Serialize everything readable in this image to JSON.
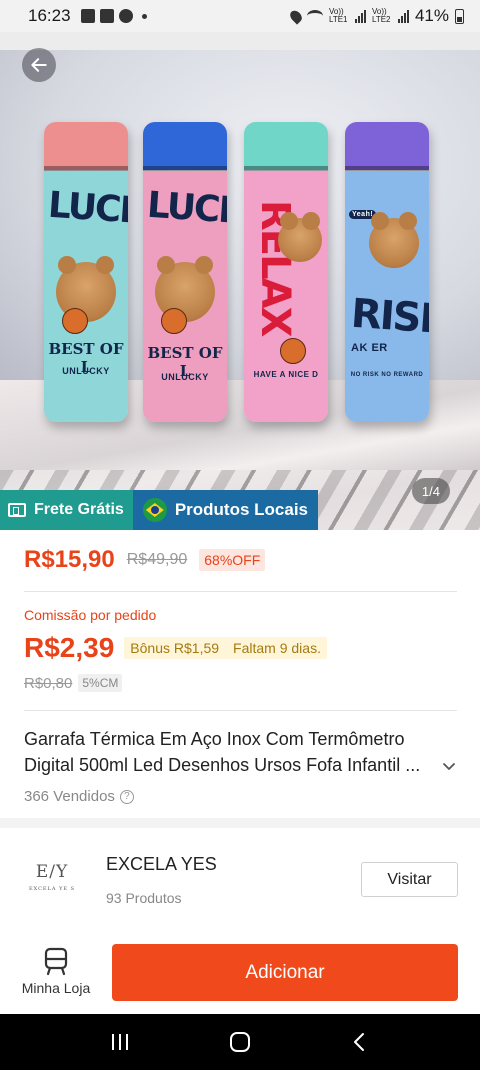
{
  "status_bar": {
    "time": "16:23",
    "battery": "41%",
    "sim1": "Vo)) LTE1",
    "sim2": "Vo)) LTE2"
  },
  "hero": {
    "counter": "1/4",
    "bottle_texts": {
      "b1_big": "LUCK",
      "b1_slogan": "BEST OF L",
      "b1_small": "UNLUCKY",
      "b2_big": "LUCK",
      "b2_slogan": "BEST OF L",
      "b2_small": "UNLUCKY",
      "b3_big": "RELAX",
      "b3_small": "HAVE A NICE D",
      "b4_big": "RISK",
      "b4_sub": "AK ER",
      "b4_small": "NO RISK NO REWARD",
      "b4_bubble": "Yeah!"
    },
    "badges": {
      "frete": "Frete Grátis",
      "locais": "Produtos Locais"
    }
  },
  "price": {
    "current": "R$15,90",
    "original": "R$49,90",
    "discount": "68%OFF"
  },
  "commission": {
    "label": "Comissão por pedido",
    "value": "R$2,39",
    "bonus": "Bônus R$1,59",
    "remaining": "Faltam 9 dias.",
    "old_value": "R$0,80",
    "rate": "5%CM"
  },
  "product": {
    "title_line1": "Garrafa Térmica Em Aço Inox Com Termômetro",
    "title_line2": "Digital 500ml Led Desenhos Ursos Fofa Infantil ...",
    "sold": "366 Vendidos"
  },
  "shop": {
    "logo_mono": "E/Y",
    "logo_sub": "EXCELA YE S",
    "name": "EXCELA YES",
    "count": "93 Produtos",
    "visit_label": "Visitar"
  },
  "bottom": {
    "my_shop_label": "Minha Loja",
    "add_label": "Adicionar"
  },
  "colors": {
    "accent": "#f04a1c",
    "price": "#e84319",
    "frete_bg": "#1f9c8f",
    "locais_bg": "#1b6aa1"
  }
}
